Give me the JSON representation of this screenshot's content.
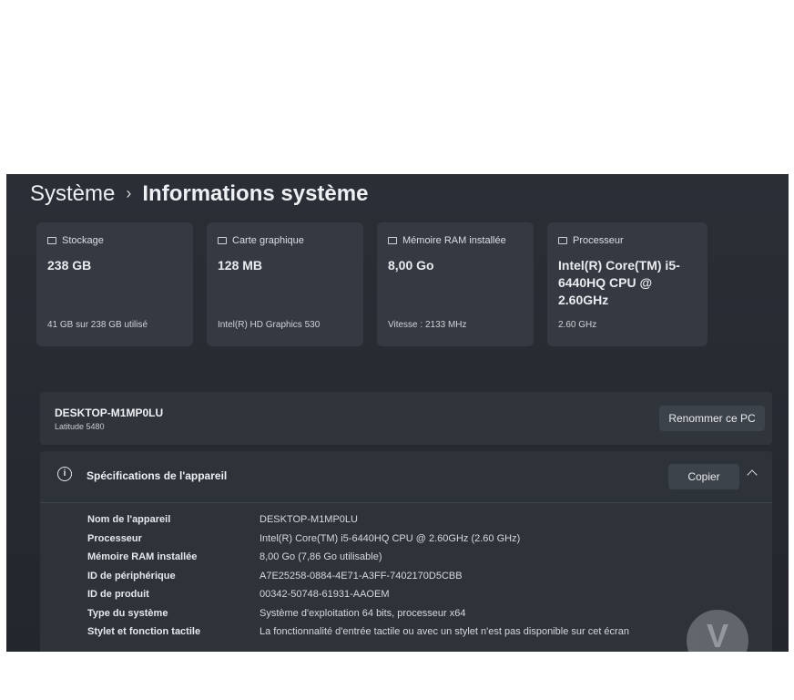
{
  "breadcrumb": {
    "parent": "Système",
    "separator": "›",
    "current": "Informations système"
  },
  "cards": [
    {
      "icon": "storage-icon",
      "label": "Stockage",
      "value": "238 GB",
      "sub": "41 GB sur 238 GB utilisé"
    },
    {
      "icon": "graphics-card-icon",
      "label": "Carte graphique",
      "value": "128 MB",
      "sub": "Intel(R) HD Graphics 530"
    },
    {
      "icon": "ram-icon",
      "label": "Mémoire RAM installée",
      "value": "8,00 Go",
      "sub": "Vitesse : 2133 MHz"
    },
    {
      "icon": "processor-icon",
      "label": "Processeur",
      "value": "Intel(R) Core(TM) i5-6440HQ CPU @ 2.60GHz",
      "sub": "2.60 GHz"
    }
  ],
  "device": {
    "name": "DESKTOP-M1MP0LU",
    "model": "Latitude 5480",
    "rename_label": "Renommer ce PC"
  },
  "specs": {
    "title": "Spécifications de l'appareil",
    "copy_label": "Copier",
    "rows": [
      {
        "key": "Nom de l'appareil",
        "value": "DESKTOP-M1MP0LU"
      },
      {
        "key": "Processeur",
        "value": "Intel(R) Core(TM) i5-6440HQ CPU @ 2.60GHz (2.60 GHz)"
      },
      {
        "key": "Mémoire RAM installée",
        "value": "8,00 Go (7,86 Go utilisable)"
      },
      {
        "key": "ID de périphérique",
        "value": "A7E25258-0884-4E71-A3FF-7402170D5CBB"
      },
      {
        "key": "ID de produit",
        "value": "00342-50748-61931-AAOEM"
      },
      {
        "key": "Type du système",
        "value": "Système d'exploitation 64 bits, processeur x64"
      },
      {
        "key": "Stylet et fonction tactile",
        "value": "La fonctionnalité d'entrée tactile ou avec un stylet n'est pas disponible sur cet écran"
      }
    ]
  },
  "watermark": {
    "text": "V"
  },
  "colors": {
    "background": "#262a31",
    "card": "#353a42",
    "text": "#eef0f3"
  }
}
